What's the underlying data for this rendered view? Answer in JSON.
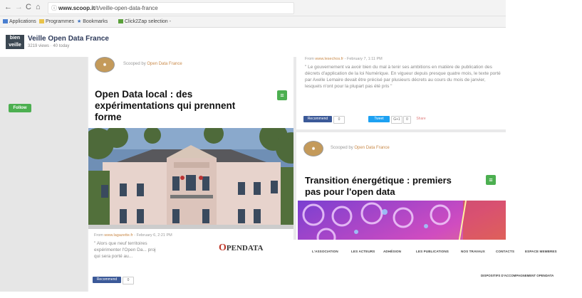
{
  "browser": {
    "url_domain": "www.scoop.it",
    "url_path": "/t/veille-open-data-france",
    "bookmarks": [
      {
        "label": "Applications",
        "color": "#4a7fd0"
      },
      {
        "label": "Programmes",
        "color": "#e9c34a"
      },
      {
        "label": "Bookmarks",
        "color": "#4a7fd0"
      },
      {
        "label": "Click2Zap selection -",
        "color": "#5aa03a"
      }
    ]
  },
  "site": {
    "logo_text": "bien veille",
    "title": "Veille Open Data France",
    "subtitle": "3219 views · 40 today"
  },
  "sidebar": {
    "follow_label": "Follow"
  },
  "post1": {
    "scooped_prefix": "Scooped by",
    "scooped_by": "Open Data France",
    "title": "Open Data local : des expérimentations qui prennent forme",
    "action_icon": "scoop-icon",
    "from_prefix": "From",
    "from_source": "www.lagazette.fr",
    "from_date": "- February 6, 2:21 PM",
    "quote": "\" Alors que neuf territoires expérimenter l'Open Da... projet qui sera porté au...",
    "share_label": "Recommend",
    "share_count": "0"
  },
  "post2": {
    "from_prefix": "From",
    "from_source": "www.lesechos.fr",
    "from_date": "- February 7, 1:11 PM",
    "quote": "\" Le gouvernement va avoir bien du mal à tenir ses ambitions en matière de publication des décrets d'application de la loi Numérique. En vigueur depuis presque quatre mois, le texte porté par Axelle Lemaire devait être précisé par plusieurs décrets au cours du mois de janvier, lesquels n'ont pour la plupart pas été pris \"",
    "recommend_label": "Recommend",
    "recommend_count": "0",
    "tweet_label": "Tweet",
    "g_label": "G+1",
    "g_count": "0",
    "share_label": "Share"
  },
  "post3": {
    "scooped_prefix": "Scooped by",
    "scooped_by": "Open Data France",
    "title": "Transition énergétique : premiers pas pour l'open data",
    "action_icon": "scoop-icon"
  },
  "overlay": {
    "logo": "PENDATA",
    "logo_first": "O",
    "menu": [
      "L'ASSOCIATION",
      "LES ACTEURS",
      "ADHÉSION",
      "LES PUBLICATIONS",
      "NOS TRAVAUX",
      "CONTACTS",
      "ESPACE MEMBRES"
    ],
    "submenu": "DISPOSITIFS D'ACCOMPAGNEMENT OPENDATA"
  },
  "colors": {
    "accent_green": "#4caf50",
    "scoop_orange": "#c98a4a",
    "title_navy": "#2d3a5a"
  }
}
